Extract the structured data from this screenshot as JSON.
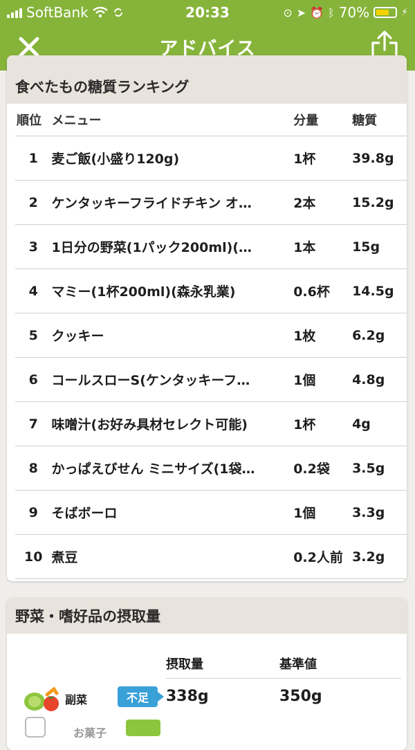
{
  "status": {
    "carrier": "SoftBank",
    "time": "20:33",
    "battery_pct": "70%",
    "battery_level": 0.7,
    "battery_color": "#f5d300"
  },
  "nav": {
    "title": "アドバイス",
    "close_icon": "close-icon",
    "share_icon": "share-icon",
    "bar_color": "#86b43a"
  },
  "ranking": {
    "title": "食べたもの糖質ランキング",
    "headers": {
      "rank": "順位",
      "menu": "メニュー",
      "qty": "分量",
      "carb": "糖質"
    },
    "rows": [
      {
        "rank": "1",
        "menu": "麦ご飯(小盛り120g)",
        "qty": "1杯",
        "carb": "39.8g"
      },
      {
        "rank": "2",
        "menu": "ケンタッキーフライドチキン オ…",
        "qty": "2本",
        "carb": "15.2g"
      },
      {
        "rank": "3",
        "menu": "1日分の野菜(1パック200ml)(…",
        "qty": "1本",
        "carb": "15g"
      },
      {
        "rank": "4",
        "menu": "マミー(1杯200ml)(森永乳業)",
        "qty": "0.6杯",
        "carb": "14.5g"
      },
      {
        "rank": "5",
        "menu": "クッキー",
        "qty": "1枚",
        "carb": "6.2g"
      },
      {
        "rank": "6",
        "menu": "コールスローS(ケンタッキーフ…",
        "qty": "1個",
        "carb": "4.8g"
      },
      {
        "rank": "7",
        "menu": "味噌汁(お好み具材セレクト可能)",
        "qty": "1杯",
        "carb": "4g"
      },
      {
        "rank": "8",
        "menu": "かっぱえびせん ミニサイズ(1袋…",
        "qty": "0.2袋",
        "carb": "3.5g"
      },
      {
        "rank": "9",
        "menu": "そばボーロ",
        "qty": "1個",
        "carb": "3.3g"
      },
      {
        "rank": "10",
        "menu": "煮豆",
        "qty": "0.2人前",
        "carb": "3.2g"
      }
    ]
  },
  "intake": {
    "title": "野菜・嗜好品の摂取量",
    "headers": {
      "amount": "摂取量",
      "reference": "基準値"
    },
    "rows": [
      {
        "label": "副菜",
        "status": "不足",
        "amount": "338g",
        "reference": "350g",
        "icon": "vegetable-icon",
        "status_color": "#3aa0d8"
      },
      {
        "label": "お菓子",
        "icon": "snack-icon",
        "status_color": "#8cc63f"
      }
    ]
  }
}
